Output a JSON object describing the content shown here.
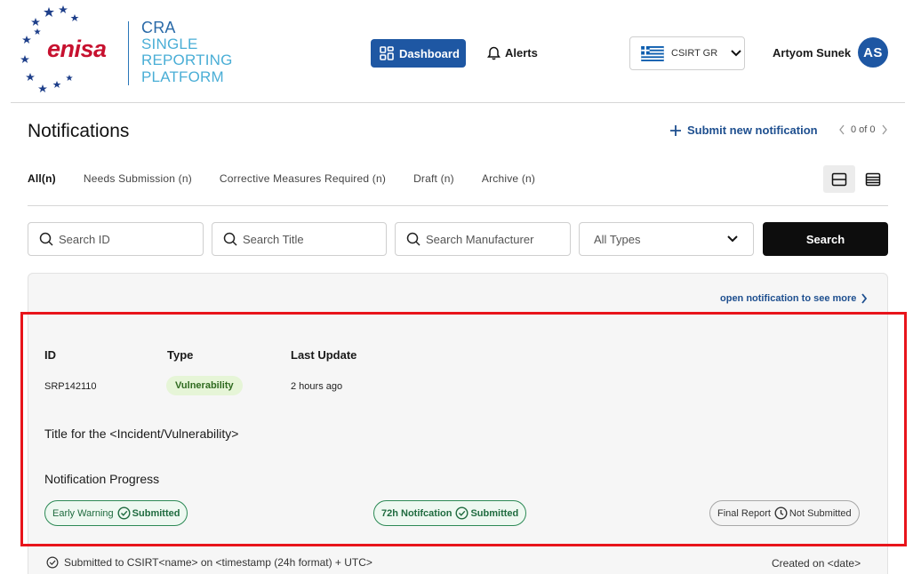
{
  "brand": {
    "logo_word": "enisa",
    "platform_lines": [
      "CRA",
      "SINGLE",
      "REPORTING",
      "PLATFORM"
    ]
  },
  "nav": {
    "dashboard_label": "Dashboard",
    "alerts_label": "Alerts"
  },
  "country": {
    "label": "CSIRT GR"
  },
  "user": {
    "name": "Artyom Sunek",
    "initials": "AS"
  },
  "page": {
    "title": "Notifications",
    "submit_new_label": "Submit new notification",
    "pager_text": "0 of 0"
  },
  "tabs": [
    {
      "label": "All(n)",
      "active": true
    },
    {
      "label": "Needs Submission (n)"
    },
    {
      "label": "Corrective Measures Required (n)"
    },
    {
      "label": "Draft (n)"
    },
    {
      "label": "Archive (n)"
    }
  ],
  "search": {
    "id_placeholder": "Search ID",
    "title_placeholder": "Search Title",
    "manufacturer_placeholder": "Search Manufacturer",
    "type_selected": "All Types",
    "button_label": "Search"
  },
  "card": {
    "open_link": "open notification to see more",
    "headers": {
      "id": "ID",
      "type": "Type",
      "last_update": "Last Update"
    },
    "id": "SRP142110",
    "type": "Vulnerability",
    "last_update": "2 hours ago",
    "title": "Title for the <Incident/Vulnerability>",
    "progress_heading": "Notification Progress",
    "progress": [
      {
        "stage": "Early Warning",
        "status": "Submitted"
      },
      {
        "stage": "72h Notifcation",
        "status": "Submitted"
      },
      {
        "stage": "Final Report",
        "status": "Not Submitted"
      }
    ],
    "submitted_line": "Submitted to CSIRT<name> on <timestamp (24h format) + UTC>",
    "created_line": "Created on <date>"
  },
  "colors": {
    "primary": "#1e57a3",
    "brand_red": "#c7112f",
    "success": "#2d8a56",
    "highlight": "#e8141b"
  }
}
